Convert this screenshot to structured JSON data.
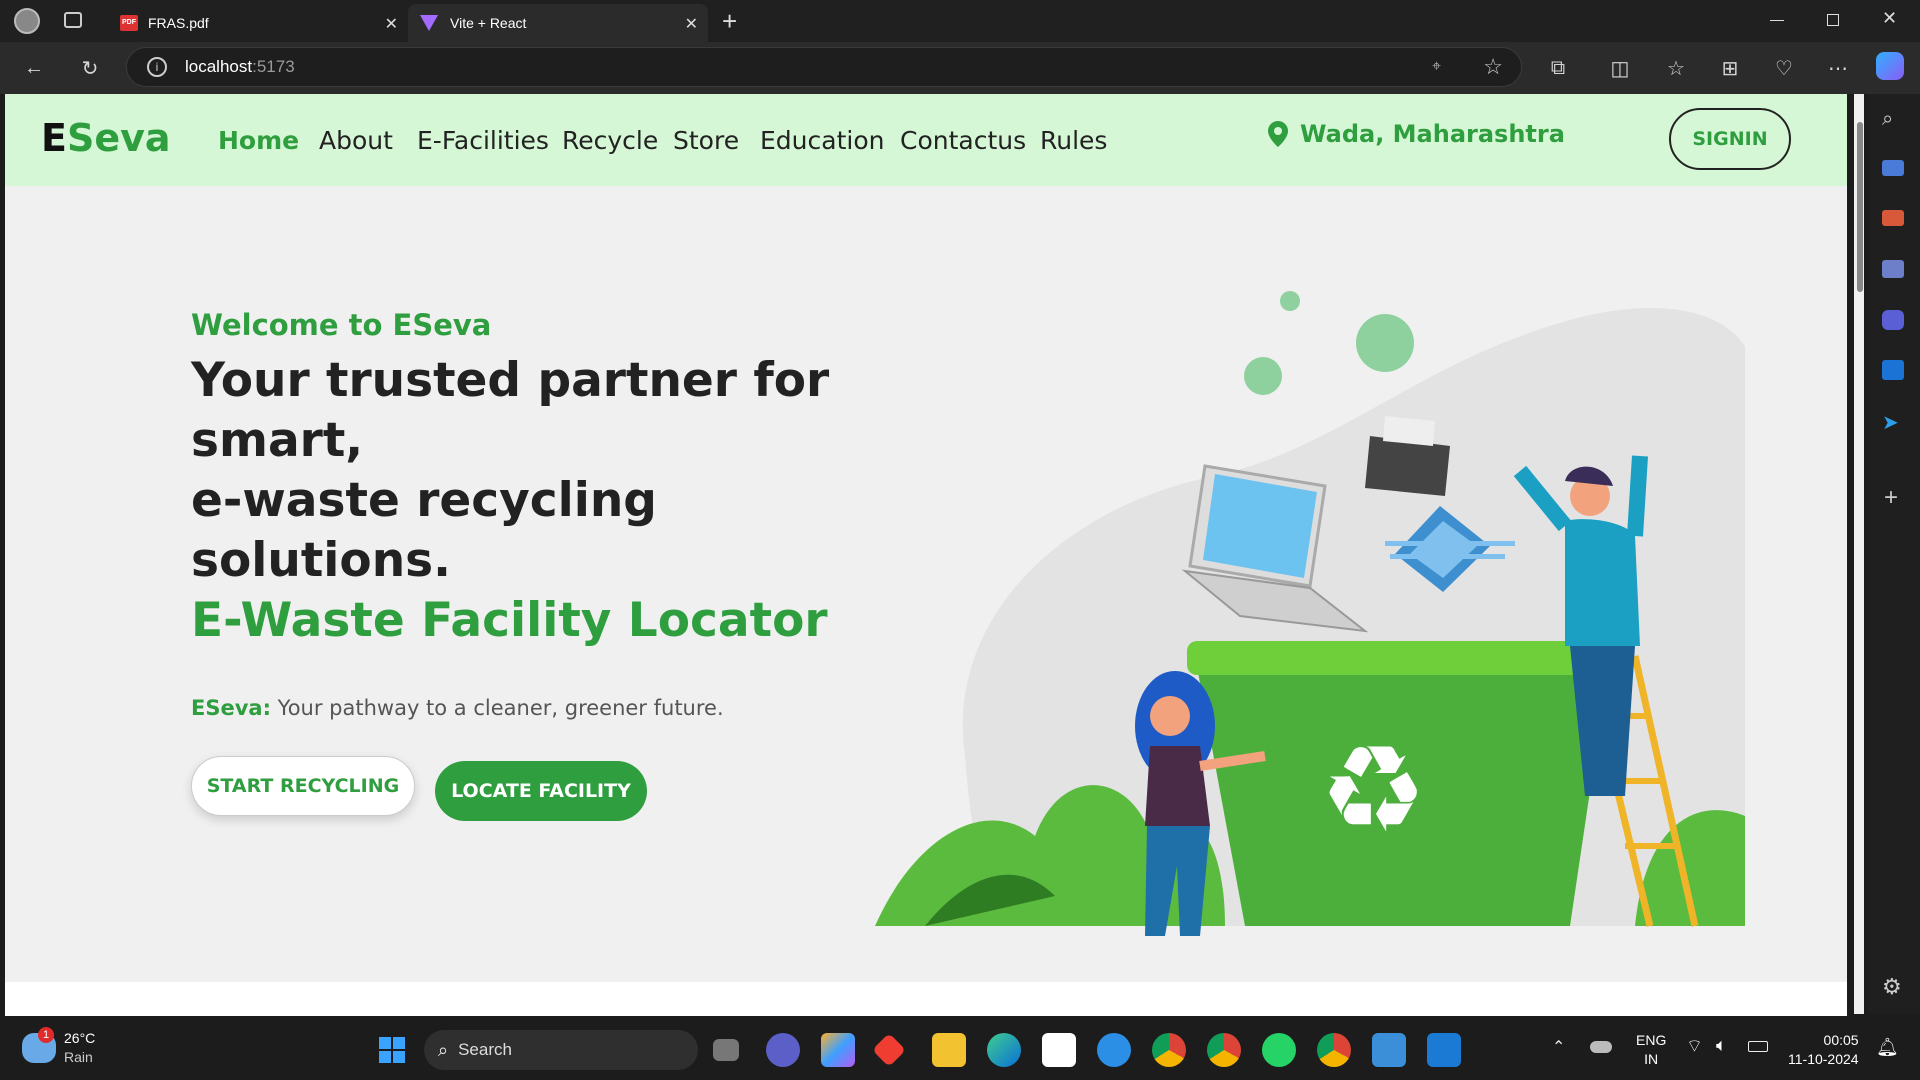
{
  "browser": {
    "tabs": [
      {
        "title": "FRAS.pdf",
        "icon": "pdf-icon"
      },
      {
        "title": "Vite + React",
        "icon": "vite-icon"
      }
    ],
    "url_host": "localhost",
    "url_port": ":5173"
  },
  "site": {
    "logo_e": "E",
    "logo_rest": "Seva",
    "nav": [
      "Home",
      "About",
      "E-Facilities",
      "Recycle",
      "Store",
      "Education",
      "Contactus",
      "Rules"
    ],
    "location": "Wada, Maharashtra",
    "signin": "SIGNIN"
  },
  "hero": {
    "welcome": "Welcome to ESeva",
    "headline_1": "Your trusted partner for",
    "headline_2": "smart,",
    "headline_3": "e-waste recycling solutions.",
    "headline_green": "E-Waste Facility Locator",
    "tagline_bold": "ESeva:",
    "tagline_rest": " Your pathway to a cleaner, greener future.",
    "btn_start": "START RECYCLING",
    "btn_locate": "LOCATE FACILITY"
  },
  "taskbar": {
    "weather_temp": "26°C",
    "weather_desc": "Rain",
    "weather_badge": "1",
    "search": "Search",
    "lang_1": "ENG",
    "lang_2": "IN",
    "time": "00:05",
    "date": "11-10-2024"
  },
  "colors": {
    "green": "#2e9e3f",
    "nav_bg": "#d6f7d6",
    "hero_bg": "#f0f0f0"
  }
}
